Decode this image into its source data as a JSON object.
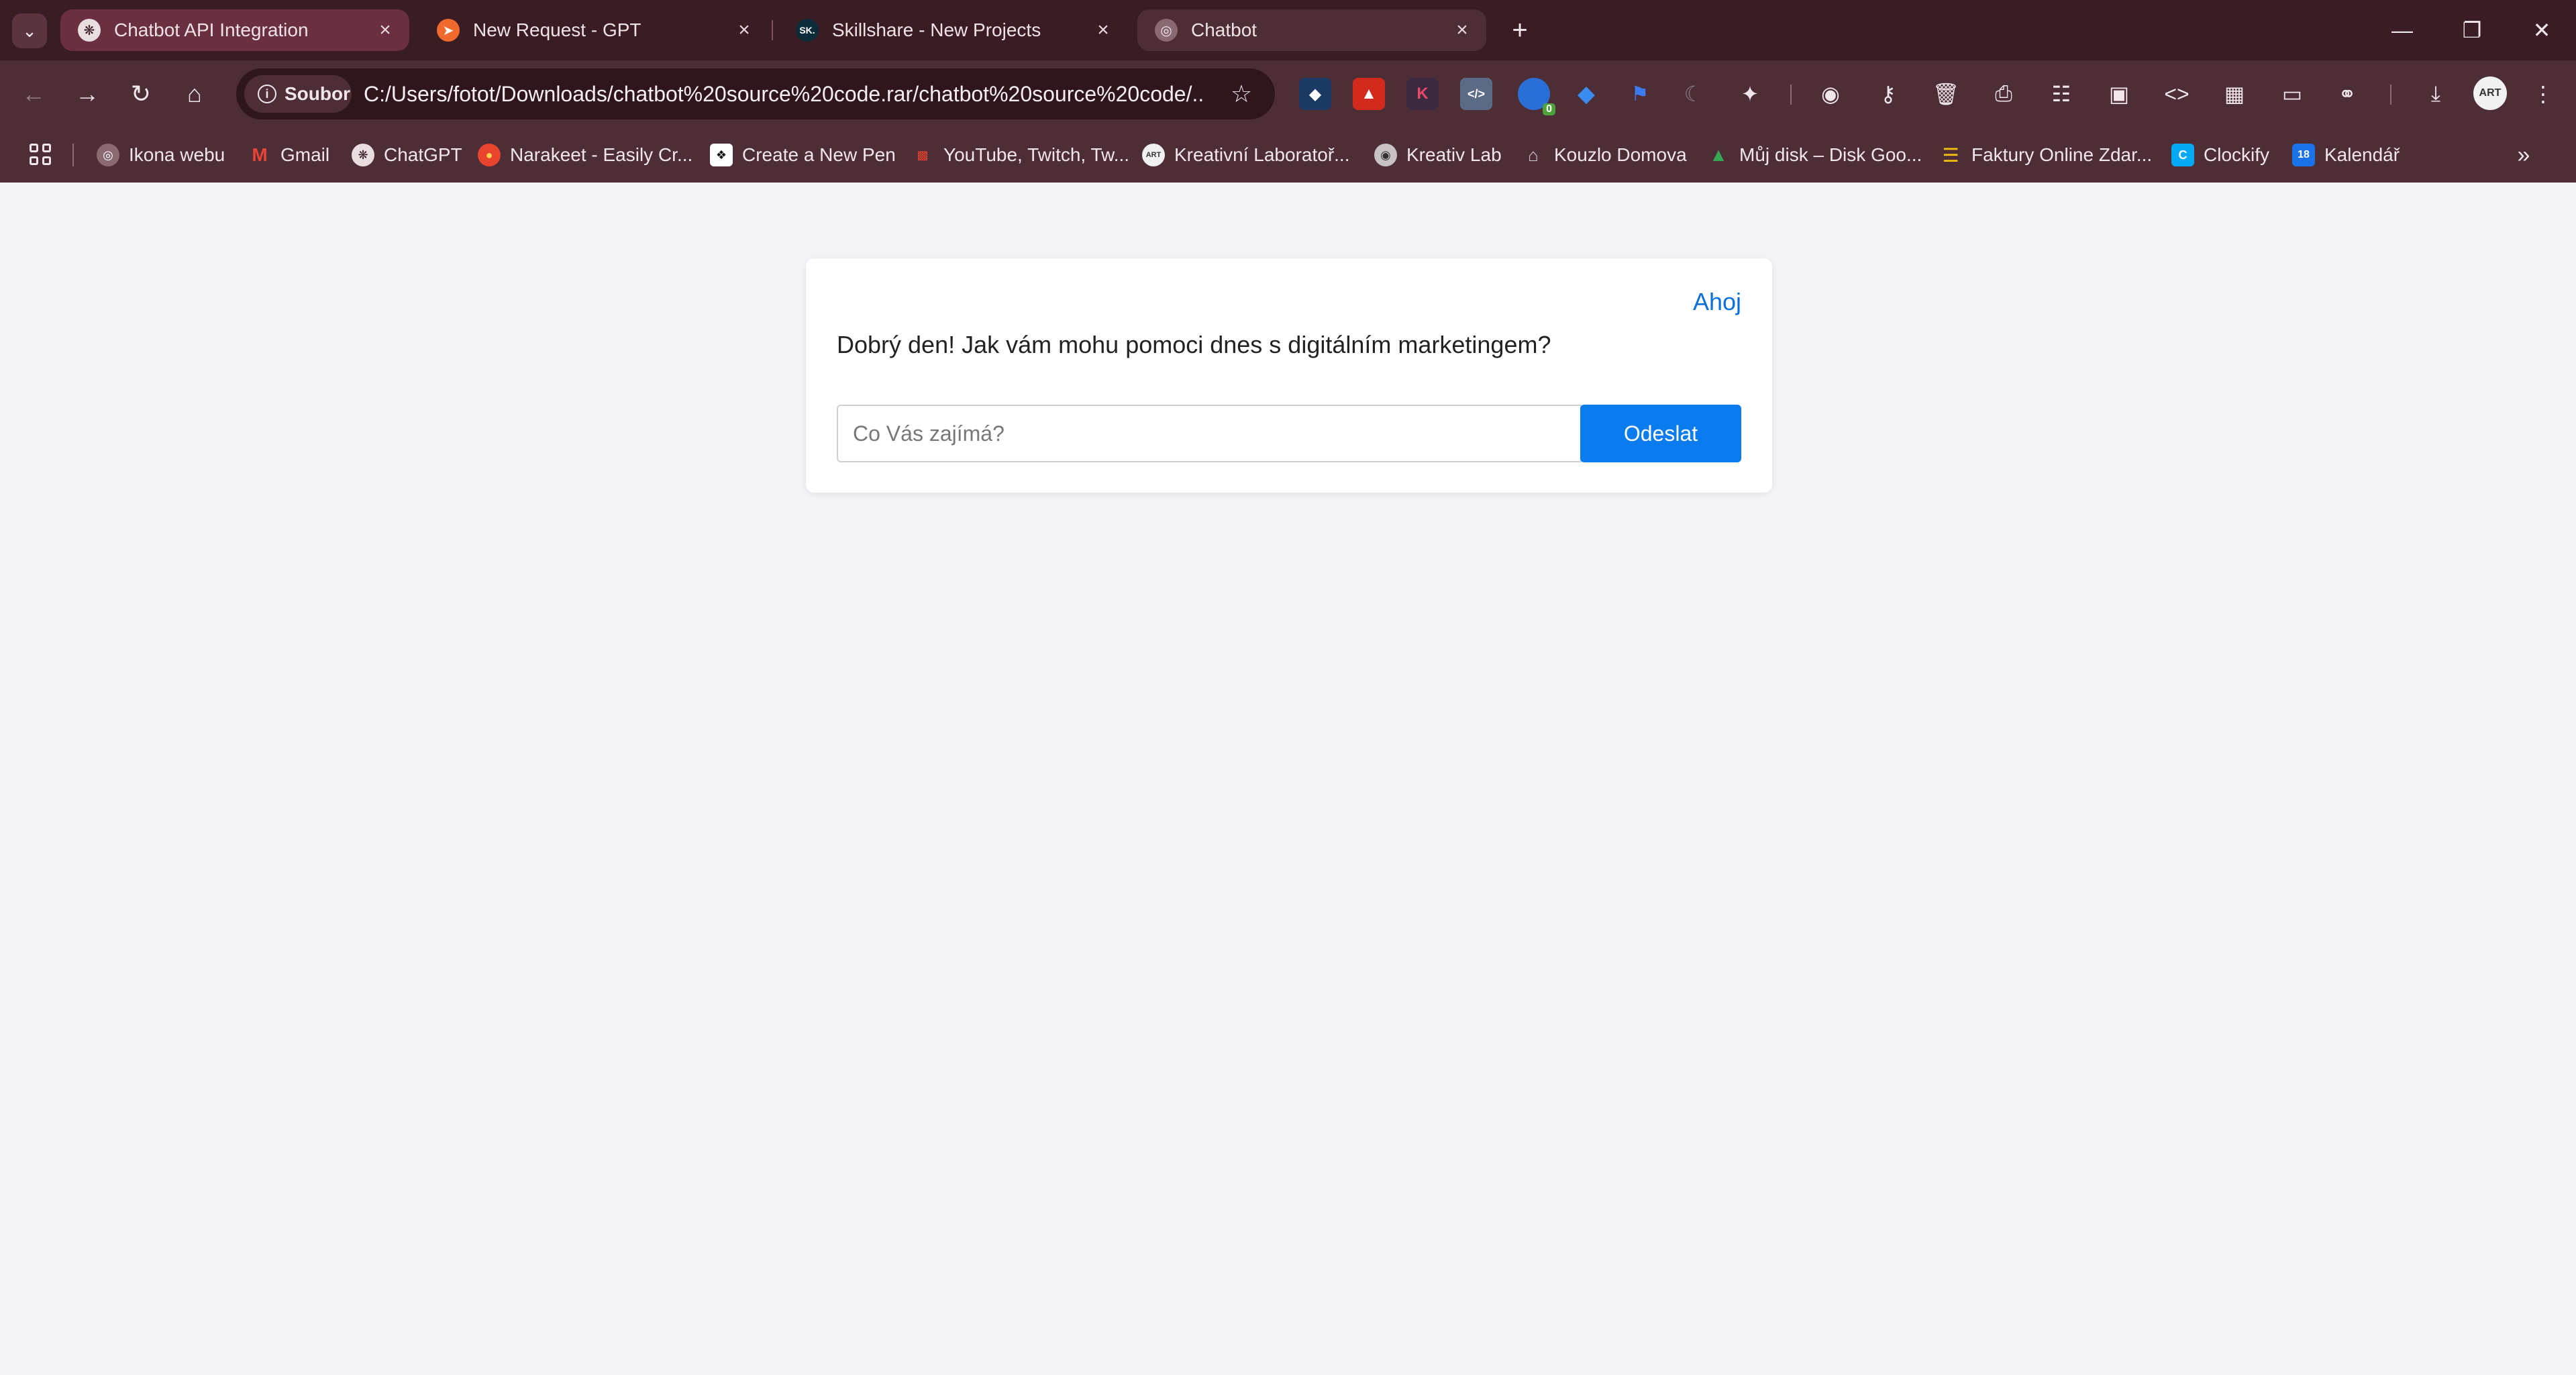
{
  "browser": {
    "tabs": [
      {
        "title": "Chatbot API Integration",
        "icon": "openai-icon"
      },
      {
        "title": "New Request - GPT",
        "icon": "postman-icon"
      },
      {
        "title": "Skillshare - New Projects",
        "icon": "skillshare-icon",
        "icon_text": "SK."
      },
      {
        "title": "Chatbot",
        "icon": "globe-icon"
      }
    ],
    "new_tab": "+",
    "omnibox": {
      "site_chip": "Soubor",
      "url": "C:/Users/fotot/Downloads/chatbot%20source%20code.rar/chatbot%20source%20code/..."
    },
    "extensions": {
      "badge_count": "0",
      "k_label": "K"
    },
    "profile_label": "ART",
    "bookmarks": [
      {
        "label": "Ikona webu",
        "icon": "globe-icon"
      },
      {
        "label": "Gmail",
        "icon": "gmail-icon",
        "icon_text": "M"
      },
      {
        "label": "ChatGPT",
        "icon": "openai-icon"
      },
      {
        "label": "Narakeet - Easily Cr...",
        "icon": "narakeet-icon"
      },
      {
        "label": "Create a New Pen",
        "icon": "codepen-icon"
      },
      {
        "label": "YouTube, Twitch, Tw...",
        "icon": "bar-chart-icon"
      },
      {
        "label": "Kreativní Laboratoř...",
        "icon": "art-icon",
        "icon_text": "ART"
      },
      {
        "label": "Kreativ Lab",
        "icon": "kreativ-lab-icon"
      },
      {
        "label": "Kouzlo Domova",
        "icon": "home-icon"
      },
      {
        "label": "Můj disk – Disk Goo...",
        "icon": "google-drive-icon"
      },
      {
        "label": "Faktury Online Zdar...",
        "icon": "invoice-icon"
      },
      {
        "label": "Clockify",
        "icon": "clockify-icon",
        "icon_text": "C"
      },
      {
        "label": "Kalendář",
        "icon": "calendar-icon",
        "icon_text": "18"
      }
    ]
  },
  "chat": {
    "header_link": "Ahoj",
    "greeting": "Dobrý den! Jak vám mohu pomoci dnes s digitálním marketingem?",
    "input_placeholder": "Co Vás zajímá?",
    "input_value": "",
    "send_label": "Odeslat"
  },
  "colors": {
    "page_bg": "#f4f3f8",
    "tabstrip_bg": "#3a1c24",
    "toolbar_bg": "#4e2e36",
    "accent": "#0b7cf0",
    "link": "#0b6fe0"
  }
}
